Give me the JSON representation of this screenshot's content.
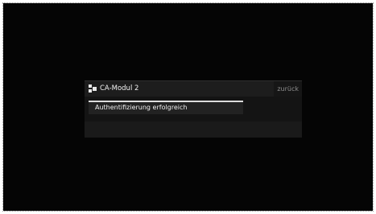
{
  "dialog": {
    "icon": "app-grid-icon",
    "title": "CA-Modul 2",
    "back_label": "zurück"
  },
  "list": {
    "items": [
      {
        "label": "Authentifizierung erfolgreich",
        "selected": true
      }
    ]
  }
}
